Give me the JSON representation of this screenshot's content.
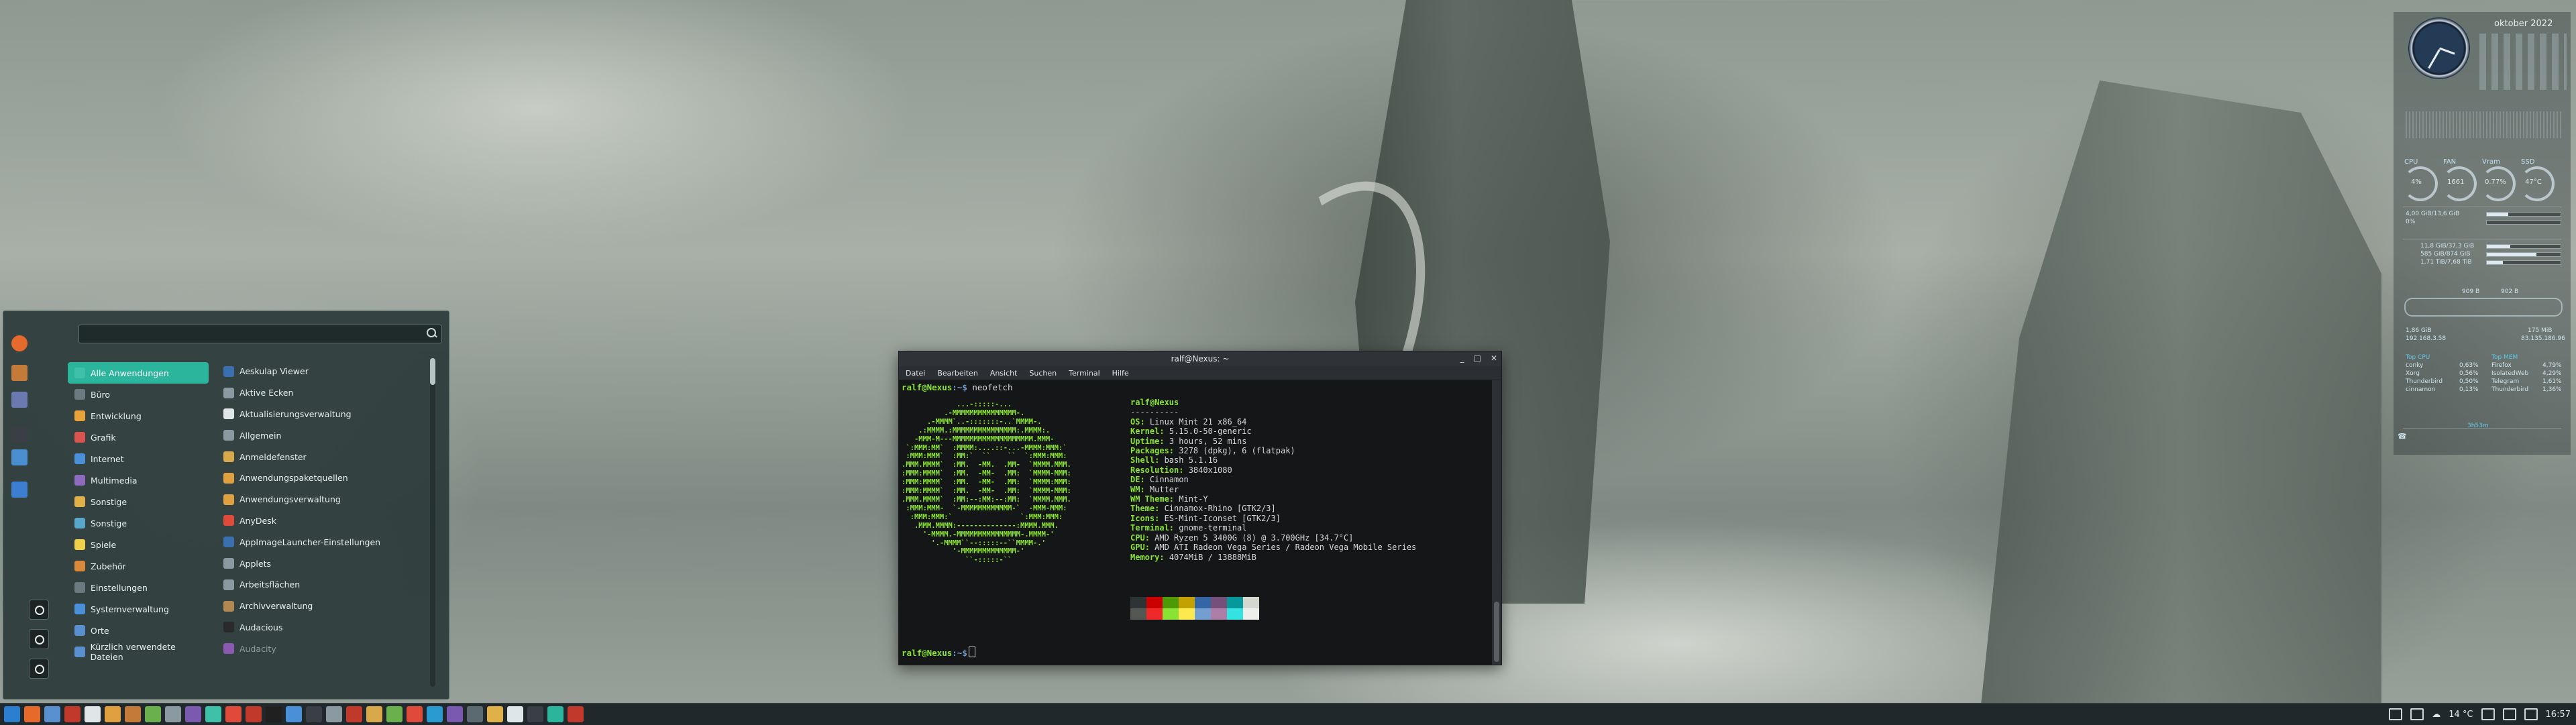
{
  "terminal": {
    "title": "ralf@Nexus: ~",
    "menu": [
      "Datei",
      "Bearbeiten",
      "Ansicht",
      "Suchen",
      "Terminal",
      "Hilfe"
    ],
    "prompt_user": "ralf@Nexus",
    "prompt_path": ":~$",
    "command": " neofetch",
    "header_user": "ralf@Nexus",
    "separator": "----------",
    "info": [
      {
        "key": "OS",
        "value": " Linux Mint 21 x86_64"
      },
      {
        "key": "Kernel",
        "value": " 5.15.0-50-generic"
      },
      {
        "key": "Uptime",
        "value": " 3 hours, 52 mins"
      },
      {
        "key": "Packages",
        "value": " 3278 (dpkg), 6 (flatpak)"
      },
      {
        "key": "Shell",
        "value": " bash 5.1.16"
      },
      {
        "key": "Resolution",
        "value": " 3840x1080"
      },
      {
        "key": "DE",
        "value": " Cinnamon"
      },
      {
        "key": "WM",
        "value": " Mutter"
      },
      {
        "key": "WM Theme",
        "value": " Mint-Y"
      },
      {
        "key": "Theme",
        "value": " Cinnamox-Rhino [GTK2/3]"
      },
      {
        "key": "Icons",
        "value": " ES-Mint-Iconset [GTK2/3]"
      },
      {
        "key": "Terminal",
        "value": " gnome-terminal"
      },
      {
        "key": "CPU",
        "value": " AMD Ryzen 5 3400G (8) @ 3.700GHz [34.7°C]"
      },
      {
        "key": "GPU",
        "value": " AMD ATI Radeon Vega Series / Radeon Vega Mobile Series"
      },
      {
        "key": "Memory",
        "value": " 4074MiB / 13888MiB"
      }
    ],
    "palette": [
      "#2e3436",
      "#cc0000",
      "#4e9a06",
      "#c4a000",
      "#3465a4",
      "#75507b",
      "#06989a",
      "#d3d7cf",
      "#555753",
      "#ef2929",
      "#8ae234",
      "#fce94f",
      "#729fcf",
      "#ad7fa8",
      "#34e2e2",
      "#eeeeec"
    ]
  },
  "menu": {
    "search_placeholder": "",
    "categories": [
      {
        "label": "Alle Anwendungen",
        "color": "#3fc1a9",
        "selected": true
      },
      {
        "label": "Büro",
        "color": "#6b7b80"
      },
      {
        "label": "Entwicklung",
        "color": "#e8a23a"
      },
      {
        "label": "Grafik",
        "color": "#d9534f"
      },
      {
        "label": "Internet",
        "color": "#4a90d9"
      },
      {
        "label": "Multimedia",
        "color": "#8e6bbf"
      },
      {
        "label": "Sonstige",
        "color": "#e0b04a"
      },
      {
        "label": "Sonstige",
        "color": "#58a6c9"
      },
      {
        "label": "Spiele",
        "color": "#f0d24a"
      },
      {
        "label": "Zubehör",
        "color": "#d88a3a"
      },
      {
        "label": "Einstellungen",
        "color": "#6b7b80"
      },
      {
        "label": "Systemverwaltung",
        "color": "#4a90d9"
      },
      {
        "label": "Orte",
        "color": "#5a8fd0"
      },
      {
        "label": "Kürzlich verwendete Dateien",
        "color": "#5a8fd0"
      }
    ],
    "apps": [
      {
        "label": "Aeskulap Viewer",
        "color": "#3a6fb0"
      },
      {
        "label": "Aktive Ecken",
        "color": "#8a9aa0"
      },
      {
        "label": "Aktualisierungsverwaltung",
        "color": "#dfe6e8"
      },
      {
        "label": "Allgemein",
        "color": "#8a9aa0"
      },
      {
        "label": "Anmeldefenster",
        "color": "#d9a84a"
      },
      {
        "label": "Anwendungspaketquellen",
        "color": "#e0a040"
      },
      {
        "label": "Anwendungsverwaltung",
        "color": "#e0a040"
      },
      {
        "label": "AnyDesk",
        "color": "#e04a3a"
      },
      {
        "label": "AppImageLauncher-Einstellungen",
        "color": "#3a6fb0"
      },
      {
        "label": "Applets",
        "color": "#8a9aa0"
      },
      {
        "label": "Arbeitsflächen",
        "color": "#8a9aa0"
      },
      {
        "label": "Archivverwaltung",
        "color": "#b08850"
      },
      {
        "label": "Audacious",
        "color": "#2a2a2a"
      },
      {
        "label": "Audacity",
        "color": "#8a5ab0",
        "dim": true
      }
    ],
    "favorites": [
      "#e66a2c",
      "#c47b3a",
      "#6a7ab0",
      "#3a3f45",
      "#4a8fd0",
      "#3c7fd0"
    ]
  },
  "conky": {
    "month": "oktober 2022",
    "gauges": [
      "CPU",
      "FAN",
      "Vram",
      "SSD"
    ],
    "gauge_values": [
      "4%",
      "1661",
      "0.77%",
      "47°C"
    ],
    "mem_lines": [
      "4,00 GiB/13,6 GiB",
      "0%"
    ],
    "disk_lines": [
      "11,8 GiB/37,3 GiB",
      "585 GiB/874 GiB",
      "1,71 TiB/7,68 TiB"
    ],
    "net_lines": [
      "909 B",
      "902 B"
    ],
    "net_stats": [
      "1,86 GiB",
      "192.168.3.58",
      "175 MiB",
      "83.135.186.96"
    ],
    "top_cpu_title": "Top CPU",
    "top_cpu": [
      {
        "name": "conky",
        "val": "0,63%"
      },
      {
        "name": "Xorg",
        "val": "0,56%"
      },
      {
        "name": "Thunderbird",
        "val": "0,50%"
      },
      {
        "name": "cinnamon",
        "val": "0,13%"
      }
    ],
    "top_mem_title": "Top MEM",
    "top_mem": [
      {
        "name": "Firefox",
        "val": "4,79%"
      },
      {
        "name": "IsolatedWeb",
        "val": "4,29%"
      },
      {
        "name": "Telegram",
        "val": "1,61%"
      },
      {
        "name": "Thunderbird",
        "val": "1,36%"
      }
    ],
    "footer": "3h53m"
  },
  "taskbar": {
    "icons": [
      "#2c7fd0",
      "#e66a2c",
      "#5a8fd0",
      "#c0392b",
      "#dfe6e8",
      "#e0a040",
      "#c47b3a",
      "#6ab04c",
      "#8a9aa0",
      "#7a5ab0",
      "#3fc1a9",
      "#e04a3a",
      "#c0392b",
      "#202020",
      "#4a90d9",
      "#3a3f45",
      "#8a9aa0",
      "#c0392b",
      "#d9a84a",
      "#6ab04c",
      "#e04a3a",
      "#2a9ad0",
      "#7a5ab0",
      "#5a6a70",
      "#e0b04a",
      "#dfe6e8",
      "#3a3f45",
      "#2bb59d",
      "#c0392b"
    ],
    "weather": "14 °C",
    "time": "16:57"
  }
}
